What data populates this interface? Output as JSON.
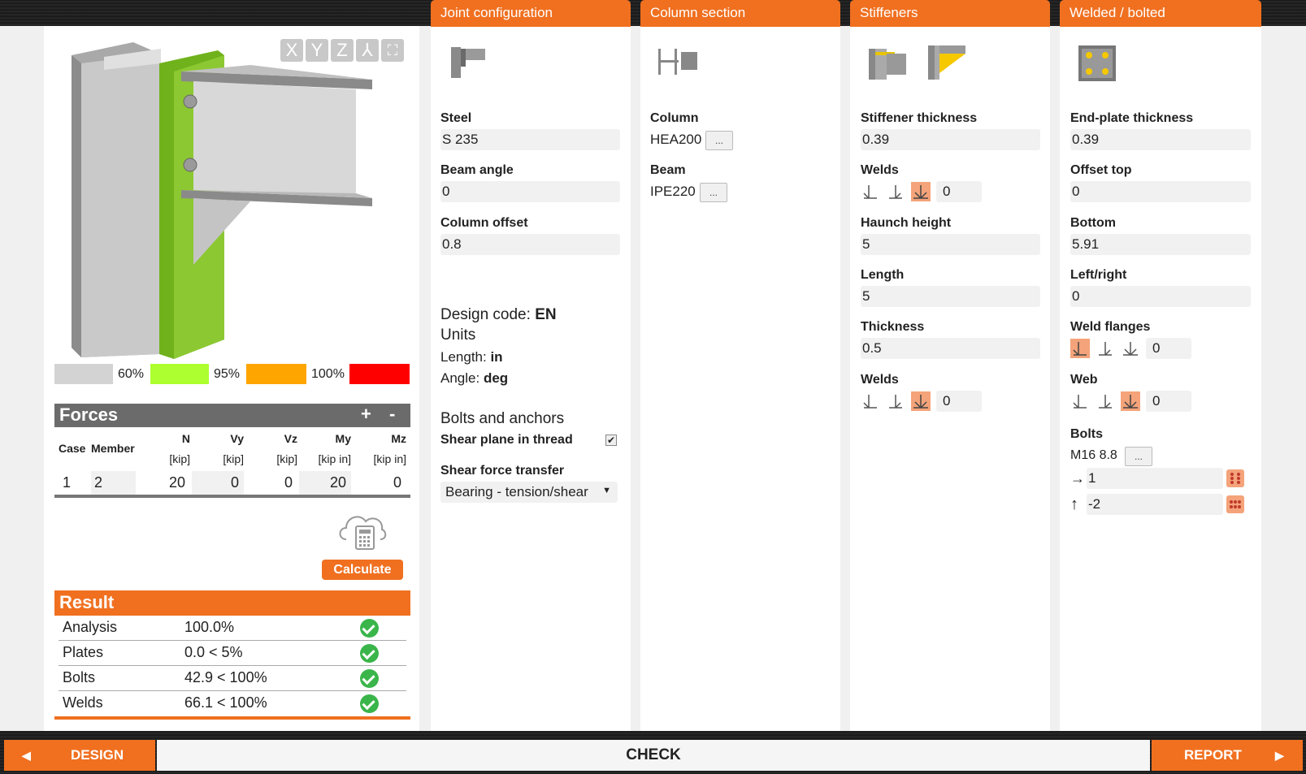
{
  "tabs": [
    "Joint configuration",
    "Column section",
    "Stiffeners",
    "Welded / bolted"
  ],
  "view": {
    "buttons": [
      "X",
      "Y",
      "Z",
      "⅄",
      "⛶"
    ]
  },
  "legend": [
    "60%",
    "95%",
    "100%"
  ],
  "legend_colors": [
    "#d3d3d3",
    "#adff2f",
    "#ffa500",
    "#ff0000"
  ],
  "forces": {
    "title": "Forces",
    "add": "+",
    "remove": "-",
    "headers": {
      "case": "Case",
      "member": "Member",
      "n": "N",
      "vy": "Vy",
      "vz": "Vz",
      "my": "My",
      "mz": "Mz"
    },
    "units": {
      "n": "[kip]",
      "vy": "[kip]",
      "vz": "[kip]",
      "my": "[kip in]",
      "mz": "[kip in]"
    },
    "row": {
      "case": "1",
      "member": "2",
      "n": "20",
      "vy": "0",
      "vz": "0",
      "my": "20",
      "mz": "0"
    }
  },
  "calculate_label": "Calculate",
  "result": {
    "title": "Result",
    "rows": [
      {
        "name": "Analysis",
        "value": "100.0%"
      },
      {
        "name": "Plates",
        "value": "0.0 < 5%"
      },
      {
        "name": "Bolts",
        "value": "42.9 < 100%"
      },
      {
        "name": "Welds",
        "value": "66.1 < 100%"
      }
    ]
  },
  "joint": {
    "steel_label": "Steel",
    "steel": "S 235",
    "beam_angle_label": "Beam angle",
    "beam_angle": "0",
    "column_offset_label": "Column offset",
    "column_offset": "0.8",
    "design_code_label": "Design code: ",
    "design_code": "EN",
    "units_label": "Units",
    "length_label": "Length: ",
    "length": "in",
    "angle_label": "Angle: ",
    "angle": "deg",
    "bolts_anchors": "Bolts and anchors",
    "shear_plane": "Shear plane in thread",
    "shear_transfer_label": "Shear force transfer",
    "shear_transfer": "Bearing - tension/shear"
  },
  "column_section": {
    "column_label": "Column",
    "column": "HEA200",
    "beam_label": "Beam",
    "beam": "IPE220",
    "dots": "..."
  },
  "stiffeners": {
    "thickness_label": "Stiffener thickness",
    "thickness": "0.39",
    "welds_label": "Welds",
    "welds_value": "0",
    "haunch_label": "Haunch height",
    "haunch": "5",
    "length_label": "Length",
    "length": "5",
    "thick2_label": "Thickness",
    "thick2": "0.5",
    "welds2_label": "Welds",
    "welds2_value": "0"
  },
  "welded": {
    "endplate_label": "End-plate thickness",
    "endplate": "0.39",
    "offset_top_label": "Offset top",
    "offset_top": "0",
    "bottom_label": "Bottom",
    "bottom": "5.91",
    "leftright_label": "Left/right",
    "leftright": "0",
    "weld_flanges_label": "Weld flanges",
    "weld_flanges": "0",
    "web_label": "Web",
    "web": "0",
    "bolts_label": "Bolts",
    "bolts": "M16 8.8",
    "dir1_arrow": "→",
    "dir1": "1",
    "dir2_arrow": "↑",
    "dir2": "-2"
  },
  "bottom": {
    "design": "DESIGN",
    "check": "CHECK",
    "report": "REPORT"
  },
  "colors": {
    "accent": "#f07020",
    "ok": "#3ab54a",
    "plate": "#6fb21c"
  }
}
